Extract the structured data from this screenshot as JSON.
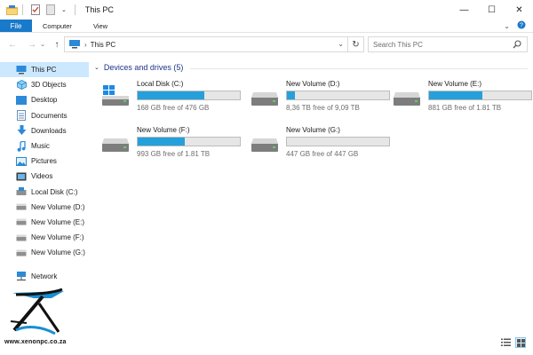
{
  "window": {
    "title": "This PC",
    "controls": {
      "minimize": "—",
      "maximize": "☐",
      "close": "✕"
    }
  },
  "ribbon": {
    "tabs": [
      "File",
      "Computer",
      "View"
    ],
    "expand_glyph": "⌄",
    "help_glyph": "?"
  },
  "address": {
    "path": "This PC",
    "chevron": "›",
    "dropdown_glyph": "⌄",
    "refresh_glyph": "↻"
  },
  "nav_glyphs": {
    "back": "←",
    "forward": "→",
    "recent": "⌄",
    "up": "↑"
  },
  "search": {
    "placeholder": "Search This PC"
  },
  "sidebar": {
    "items": [
      {
        "label": "This PC",
        "icon": "pc-icon",
        "selected": true
      },
      {
        "label": "3D Objects",
        "icon": "cube-icon"
      },
      {
        "label": "Desktop",
        "icon": "desktop-icon"
      },
      {
        "label": "Documents",
        "icon": "documents-icon"
      },
      {
        "label": "Downloads",
        "icon": "download-icon"
      },
      {
        "label": "Music",
        "icon": "music-icon"
      },
      {
        "label": "Pictures",
        "icon": "pictures-icon"
      },
      {
        "label": "Videos",
        "icon": "videos-icon"
      },
      {
        "label": "Local Disk (C:)",
        "icon": "system-drive-icon"
      },
      {
        "label": "New Volume (D:)",
        "icon": "drive-icon"
      },
      {
        "label": "New Volume (E:)",
        "icon": "drive-icon"
      },
      {
        "label": "New Volume (F:)",
        "icon": "drive-icon"
      },
      {
        "label": "New Volume (G:)",
        "icon": "drive-icon"
      }
    ],
    "network": {
      "label": "Network",
      "icon": "network-icon"
    }
  },
  "content": {
    "section_title": "Devices and drives (5)",
    "drives": [
      {
        "name": "Local Disk (C:)",
        "free_text": "168 GB free of 476 GB",
        "used_fraction": 0.65,
        "system": true
      },
      {
        "name": "New Volume (D:)",
        "free_text": "8,36 TB free of 9,09 TB",
        "used_fraction": 0.08
      },
      {
        "name": "New Volume (E:)",
        "free_text": "881 GB free of 1.81 TB",
        "used_fraction": 0.52
      },
      {
        "name": "New Volume (F:)",
        "free_text": "993 GB free of 1.81 TB",
        "used_fraction": 0.46
      },
      {
        "name": "New Volume (G:)",
        "free_text": "447 GB free of 447 GB",
        "used_fraction": 0.0
      }
    ]
  },
  "watermark": {
    "url": "www.xenonpc.co.za"
  },
  "colors": {
    "accent": "#1979ca",
    "bar_fill": "#26a0da",
    "selection": "#cce8ff",
    "section_title": "#1e3287"
  }
}
